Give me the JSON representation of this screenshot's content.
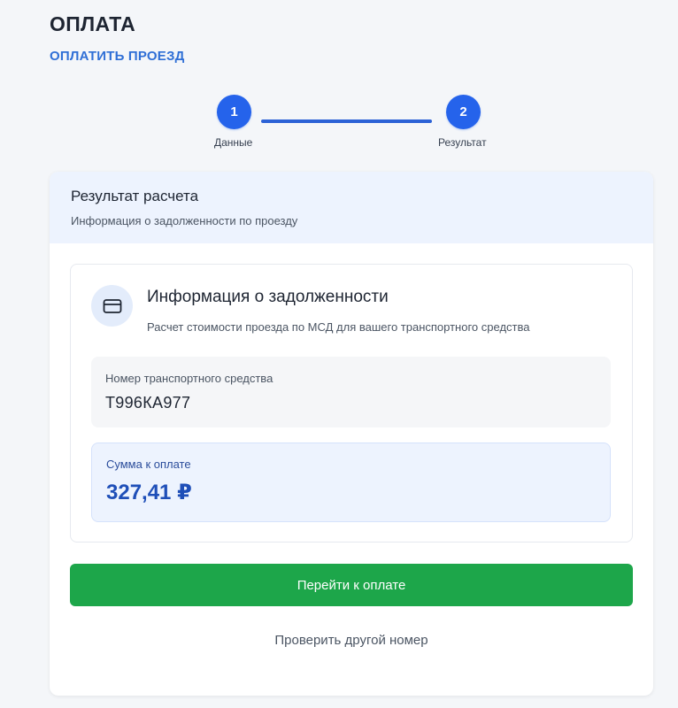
{
  "header": {
    "title": "ОПЛАТА",
    "subtitle_link": "ОПЛАТИТЬ ПРОЕЗД"
  },
  "stepper": {
    "steps": [
      {
        "number": "1",
        "label": "Данные"
      },
      {
        "number": "2",
        "label": "Результат"
      }
    ],
    "current": 2
  },
  "result_card": {
    "title": "Результат расчета",
    "subtitle": "Информация о задолженности по проезду",
    "debt_info": {
      "icon": "credit-card-icon",
      "title": "Информация о задолженности",
      "description": "Расчет стоимости проезда по МСД для вашего транспортного средства",
      "vehicle_label": "Номер транспортного средства",
      "vehicle_number": "Т996КА977",
      "amount_label": "Сумма к оплате",
      "amount_value": "327,41 ₽"
    },
    "pay_button_label": "Перейти к оплате",
    "check_other_label": "Проверить другой номер"
  },
  "colors": {
    "accent": "#2563eb",
    "pay_button": "#1da64a",
    "header_bg": "#edf3fe"
  }
}
